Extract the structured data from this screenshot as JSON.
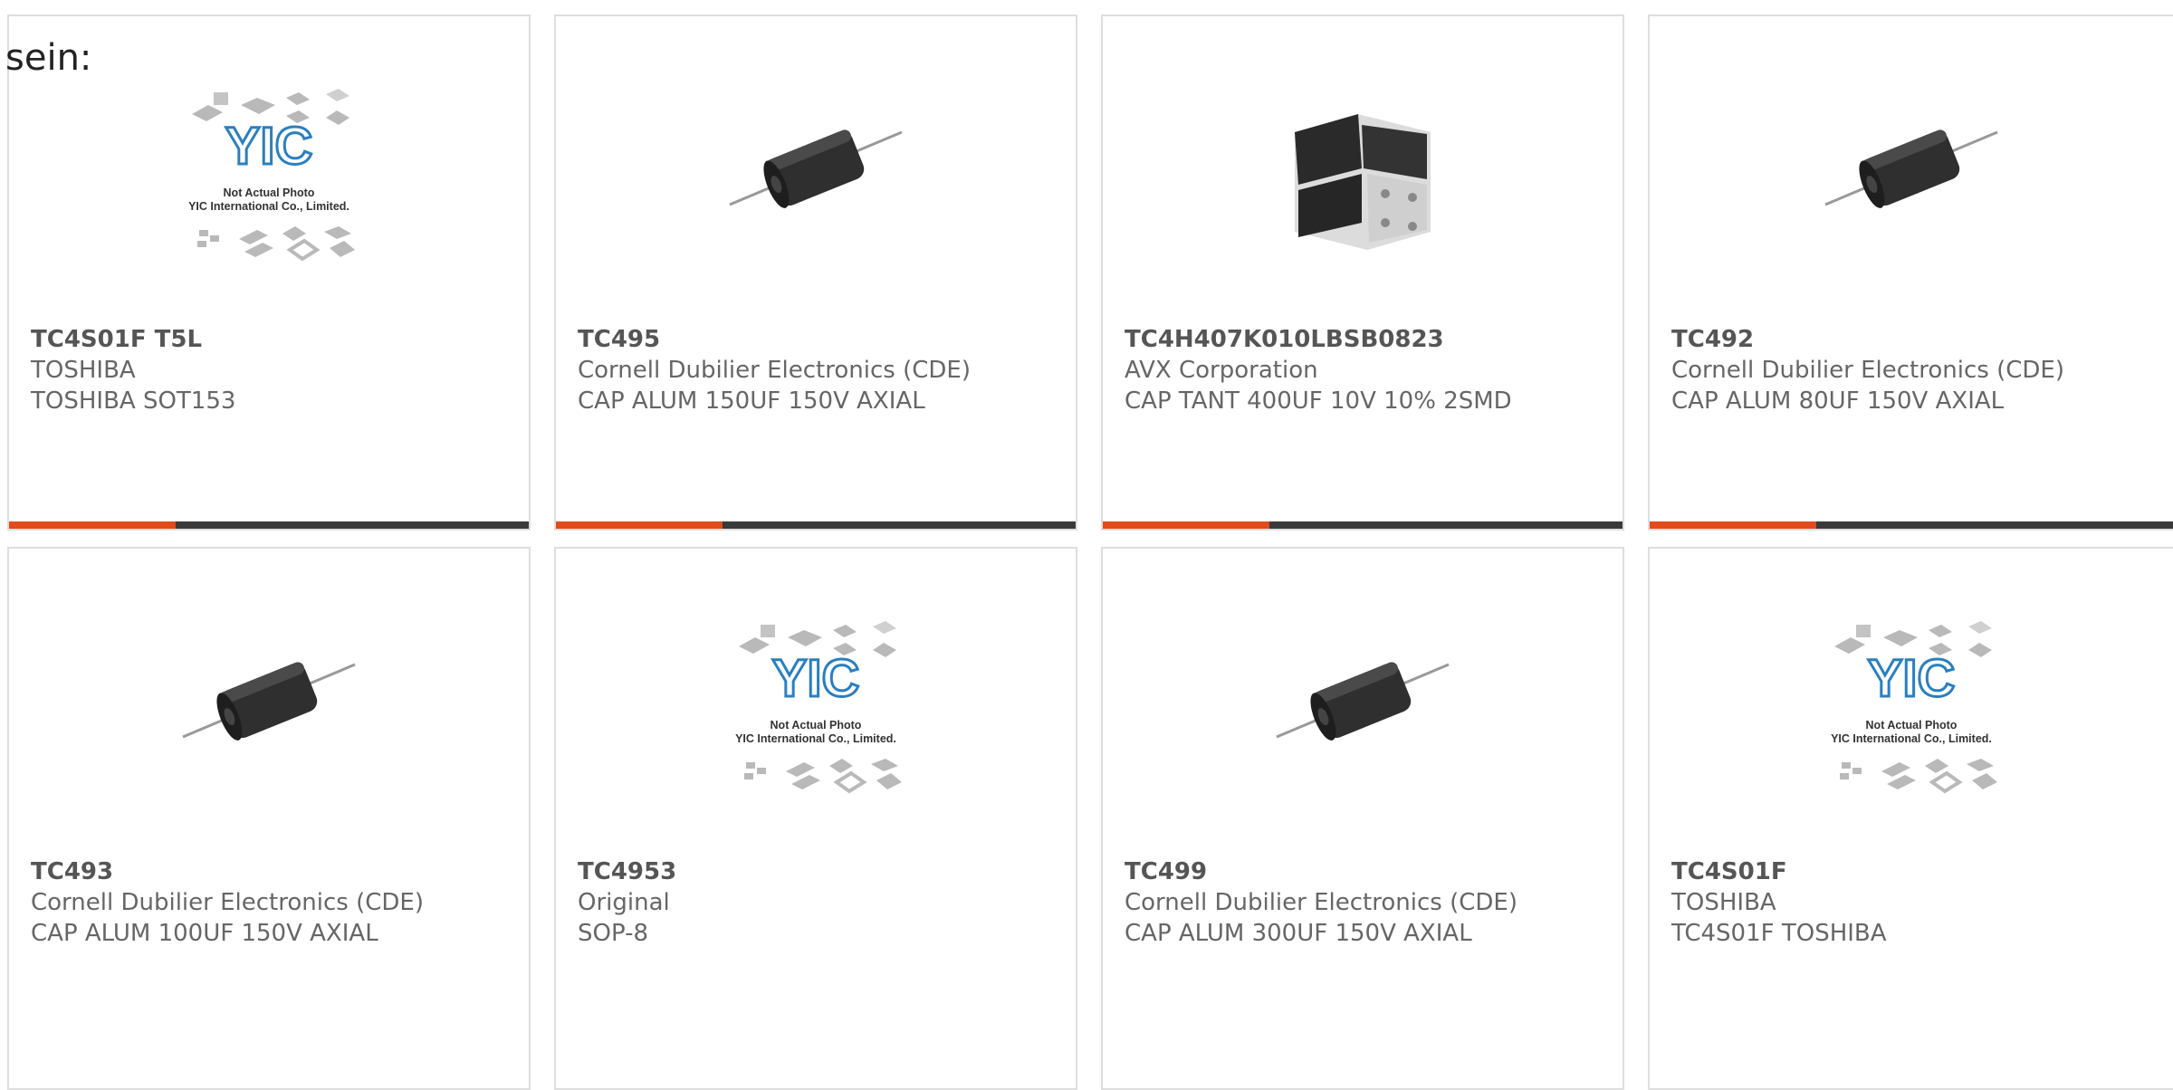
{
  "intro_text": "sein:",
  "accent_color": "#e34a1c",
  "bar_color": "#3a3a3a",
  "placeholder_image": {
    "caption_line1": "Not Actual Photo",
    "caption_line2": "YIC International Co., Limited.",
    "logo_text": "YIC"
  },
  "products": [
    {
      "part_number": "TC4S01F T5L",
      "manufacturer": "TOSHIBA",
      "description": "TOSHIBA SOT153",
      "image": "placeholder-chips-image"
    },
    {
      "part_number": "TC495",
      "manufacturer": "Cornell Dubilier Electronics (CDE)",
      "description": "CAP ALUM 150UF 150V AXIAL",
      "image": "axial-capacitor-image"
    },
    {
      "part_number": "TC4H407K010LBSB0823",
      "manufacturer": "AVX Corporation",
      "description": "CAP TANT 400UF 10V 10% 2SMD",
      "image": "tantalum-capacitor-image"
    },
    {
      "part_number": "TC492",
      "manufacturer": "Cornell Dubilier Electronics (CDE)",
      "description": "CAP ALUM 80UF 150V AXIAL",
      "image": "axial-capacitor-image"
    },
    {
      "part_number": "TC493",
      "manufacturer": "Cornell Dubilier Electronics (CDE)",
      "description": "CAP ALUM 100UF 150V AXIAL",
      "image": "axial-capacitor-image"
    },
    {
      "part_number": "TC4953",
      "manufacturer": "Original",
      "description": "SOP-8",
      "image": "placeholder-chips-image"
    },
    {
      "part_number": "TC499",
      "manufacturer": "Cornell Dubilier Electronics (CDE)",
      "description": "CAP ALUM 300UF 150V AXIAL",
      "image": "axial-capacitor-image"
    },
    {
      "part_number": "TC4S01F",
      "manufacturer": "TOSHIBA",
      "description": "TC4S01F TOSHIBA",
      "image": "placeholder-chips-image"
    }
  ]
}
